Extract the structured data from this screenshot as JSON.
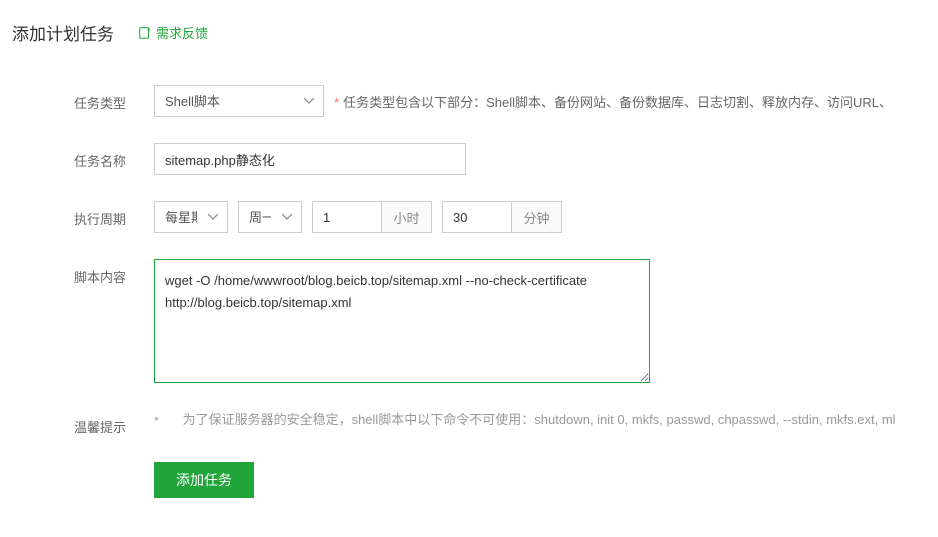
{
  "header": {
    "title": "添加计划任务",
    "feedback_label": "需求反馈"
  },
  "labels": {
    "task_type": "任务类型",
    "task_name": "任务名称",
    "exec_period": "执行周期",
    "script_content": "脚本内容",
    "tips": "温馨提示"
  },
  "task_type": {
    "selected": "Shell脚本",
    "hint": "任务类型包含以下部分：Shell脚本、备份网站、备份数据库、日志切割、释放内存、访问URL、"
  },
  "task_name": {
    "value": "sitemap.php静态化"
  },
  "period": {
    "freq_selected": "每星期",
    "day_selected": "周一",
    "hour_value": "1",
    "hour_unit": "小时",
    "minute_value": "30",
    "minute_unit": "分钟"
  },
  "script": {
    "value": "wget -O /home/wwwroot/blog.beicb.top/sitemap.xml --no-check-certificate http://blog.beicb.top/sitemap.xml"
  },
  "tips": {
    "bullet": "•",
    "text": "为了保证服务器的安全稳定，shell脚本中以下命令不可使用：shutdown, init 0, mkfs, passwd, chpasswd, --stdin, mkfs.ext, ml"
  },
  "submit": {
    "label": "添加任务"
  }
}
